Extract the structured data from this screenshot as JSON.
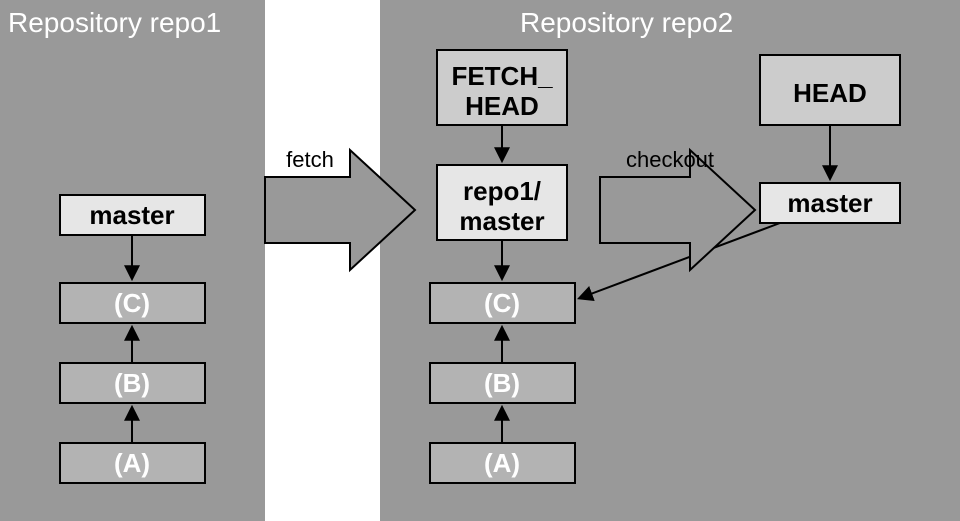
{
  "repo1": {
    "title": "Repository repo1",
    "branch": "master",
    "commits": {
      "c": "(C)",
      "b": "(B)",
      "a": "(A)"
    }
  },
  "repo2": {
    "title": "Repository repo2",
    "fetch_head": "FETCH_\nHEAD",
    "remote_branch": "repo1/\nmaster",
    "commits": {
      "c": "(C)",
      "b": "(B)",
      "a": "(A)"
    },
    "head": "HEAD",
    "branch": "master"
  },
  "ops": {
    "fetch": "fetch",
    "checkout": "checkout"
  }
}
